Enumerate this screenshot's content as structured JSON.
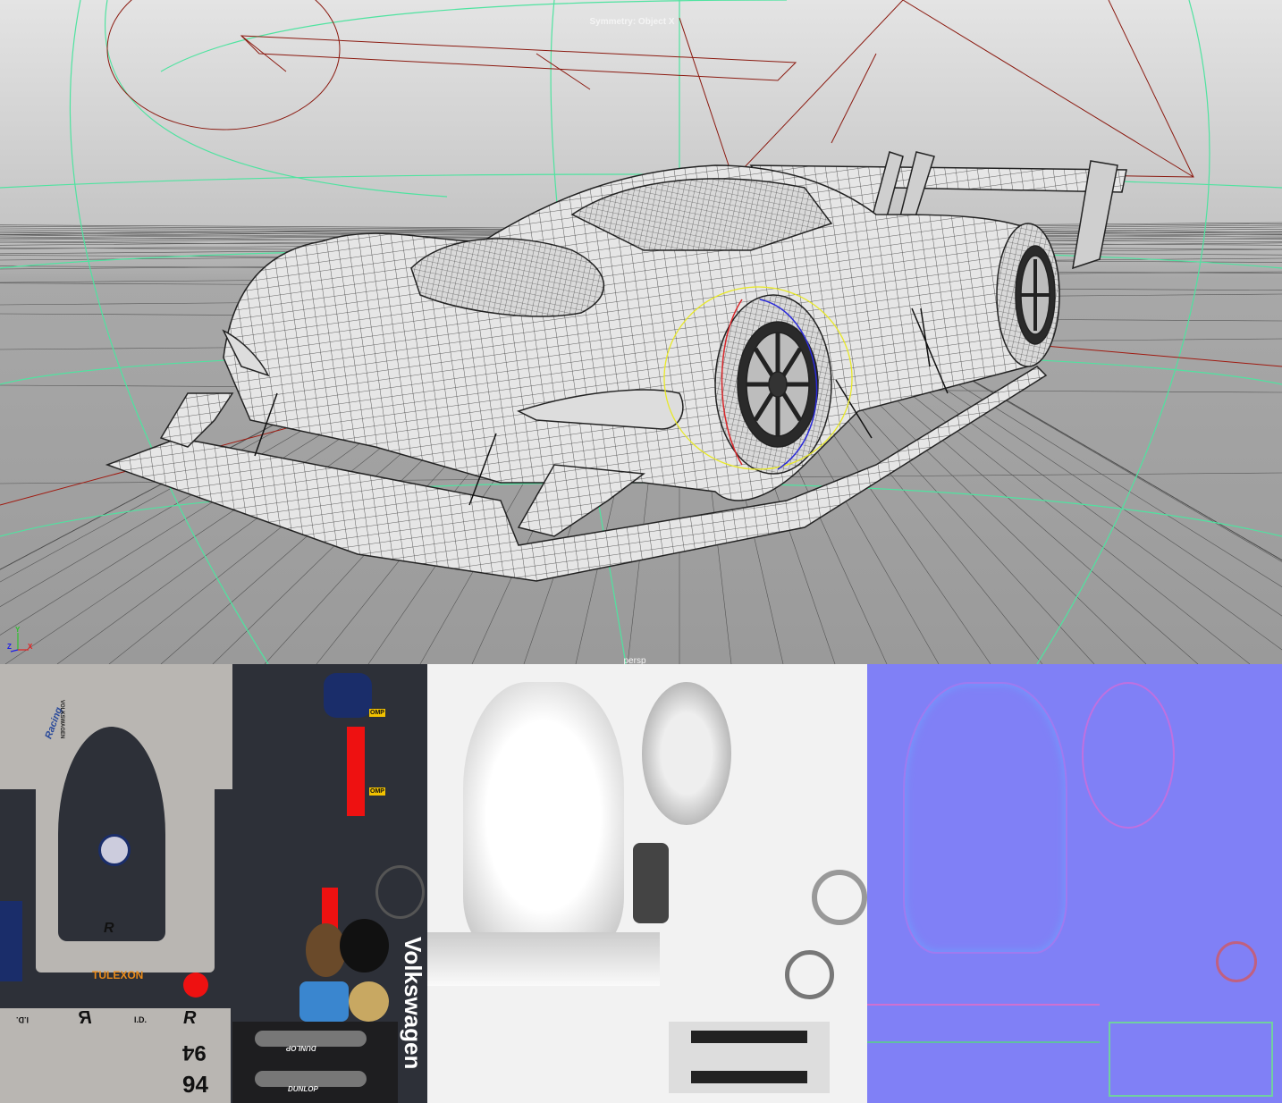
{
  "viewport": {
    "symmetry_label": "Symmetry: Object X",
    "camera_label": "persp",
    "axis": {
      "x": "X",
      "y": "Y",
      "z": "Z"
    },
    "colors": {
      "grid_bg_top": "#e2e2e2",
      "grid_bg_bottom": "#9b9b9b",
      "wire_green": "#4fe3a0",
      "curve_red": "#8b1a10",
      "selection_yellow": "#e8e82a"
    }
  },
  "textures": {
    "diffuse": {
      "sponsor": "TULEXON",
      "number": "94",
      "number_mirrored": "94",
      "brand_vertical": "Volkswagen",
      "tyre_brand": "DUNLOP",
      "tyre_brand_mirrored": "DUNLOP",
      "omp_1": "OMP",
      "omp_2": "OMP",
      "r_logo": "R",
      "id_logo": "I.D.",
      "racing_label": "Racing",
      "vw_label": "VOLKSWAGEN"
    },
    "ambient_occlusion": {},
    "normal_map": {}
  }
}
